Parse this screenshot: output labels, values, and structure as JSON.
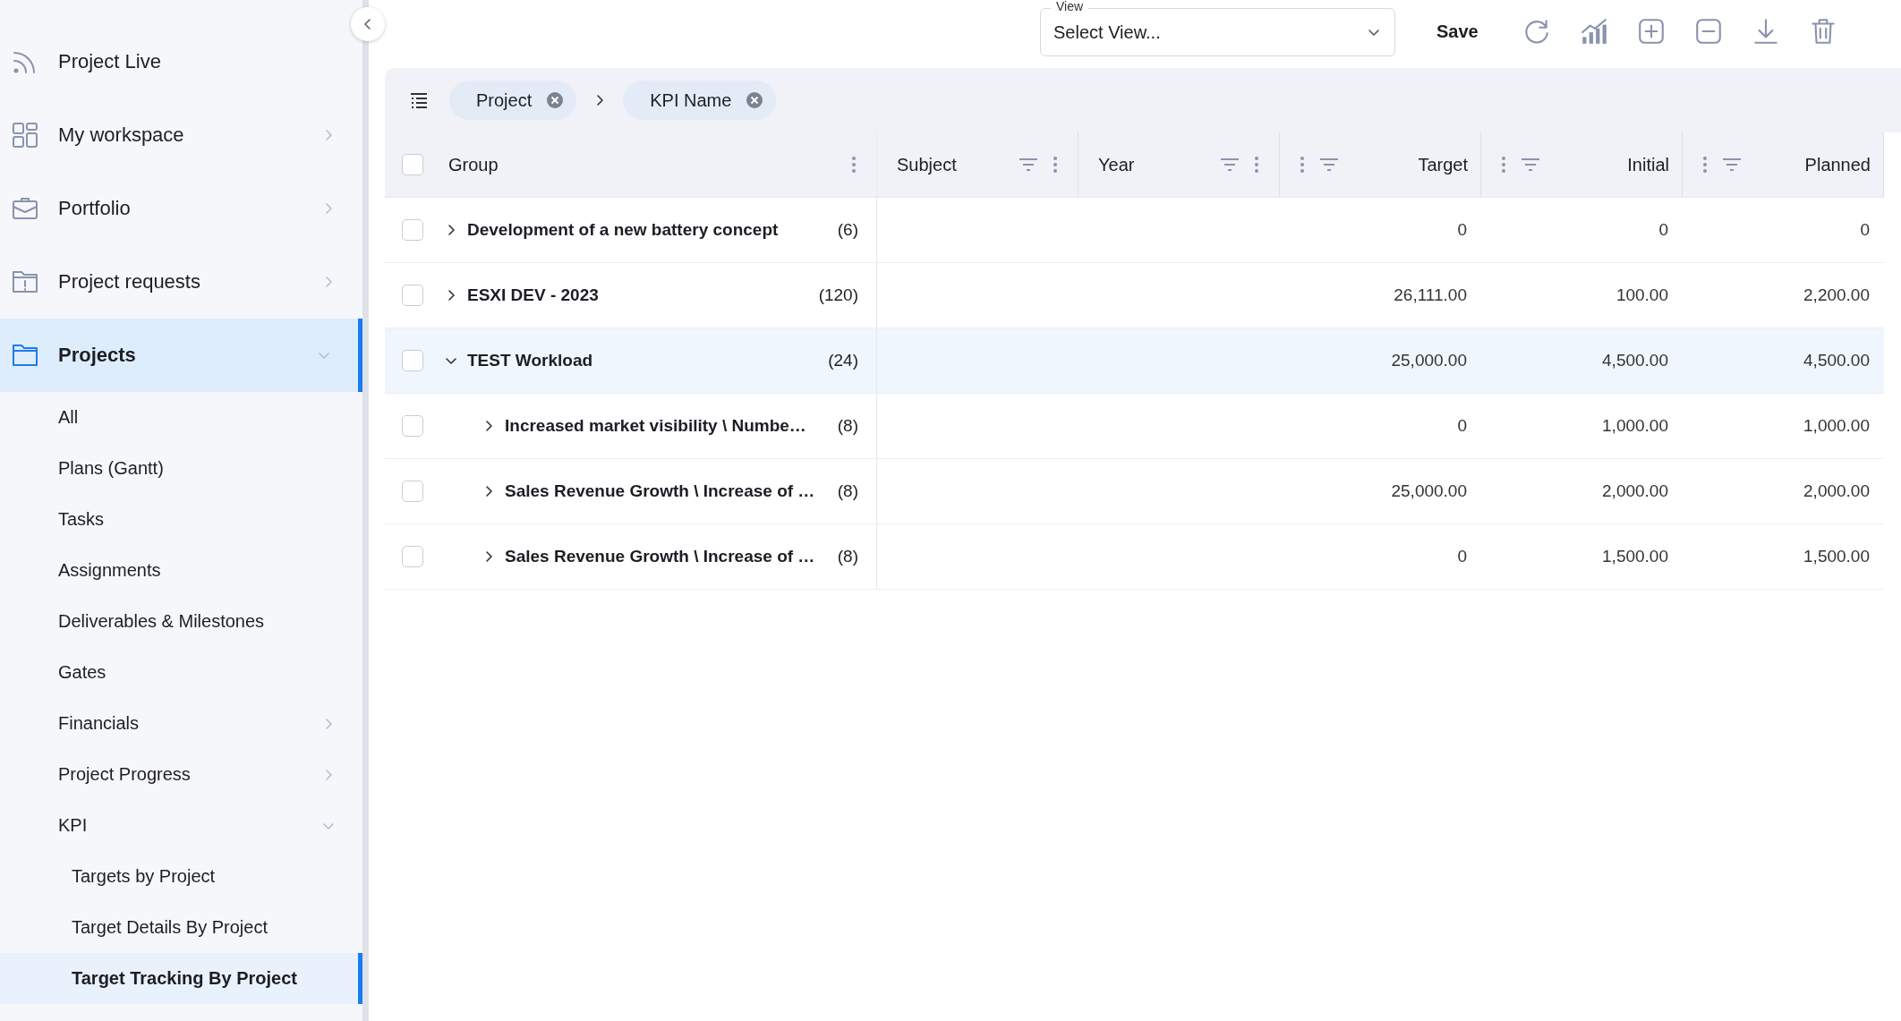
{
  "sidebar": {
    "items": [
      {
        "label": "Project Live",
        "kind": "rss",
        "selected": false
      },
      {
        "label": "My workspace",
        "kind": "grid",
        "expanded": false,
        "selected": false
      },
      {
        "label": "Portfolio",
        "kind": "briefcase",
        "expanded": false,
        "selected": false
      },
      {
        "label": "Project requests",
        "kind": "request",
        "expanded": false,
        "selected": false
      },
      {
        "label": "Projects",
        "kind": "folder",
        "expanded": true,
        "selected": true,
        "children": [
          {
            "label": "All",
            "selected": false
          },
          {
            "label": "Plans (Gantt)",
            "selected": false
          },
          {
            "label": "Tasks",
            "selected": false
          },
          {
            "label": "Assignments",
            "selected": false
          },
          {
            "label": "Deliverables & Milestones",
            "selected": false
          },
          {
            "label": "Gates",
            "selected": false
          },
          {
            "label": "Financials",
            "expanded": false,
            "selected": false
          },
          {
            "label": "Project Progress",
            "expanded": false,
            "selected": false
          },
          {
            "label": "KPI",
            "expanded": true,
            "selected": false,
            "children": [
              {
                "label": "Targets by Project",
                "selected": false
              },
              {
                "label": "Target Details By Project",
                "selected": false
              },
              {
                "label": "Target Tracking By Project",
                "selected": true
              }
            ]
          }
        ]
      }
    ]
  },
  "toolbar": {
    "view_field": {
      "label": "View",
      "placeholder": "Select View..."
    },
    "save_button": "Save",
    "actions": [
      {
        "kind": "refresh"
      },
      {
        "kind": "chart"
      },
      {
        "kind": "add"
      },
      {
        "kind": "remove"
      },
      {
        "kind": "download"
      },
      {
        "kind": "delete"
      }
    ]
  },
  "grid": {
    "group_panel": {
      "chips": [
        {
          "label": "Project"
        },
        {
          "label": "KPI Name"
        }
      ]
    },
    "header_checkbox": {
      "checked": false
    },
    "columns": [
      {
        "label": "Group",
        "kind": "group"
      },
      {
        "label": "Subject",
        "kind": "text"
      },
      {
        "label": "Year",
        "kind": "text"
      },
      {
        "label": "Target",
        "kind": "number"
      },
      {
        "label": "Initial",
        "kind": "number"
      },
      {
        "label": "Planned",
        "kind": "number"
      }
    ],
    "rows": [
      {
        "label": "Development of a new battery concept",
        "count": "(6)",
        "expanded": false,
        "selected": false,
        "checked": false,
        "values": [
          "0",
          "0",
          "0"
        ]
      },
      {
        "label": "ESXI DEV - 2023",
        "count": "(120)",
        "expanded": false,
        "selected": false,
        "checked": false,
        "values": [
          "26,111.00",
          "100.00",
          "2,200.00"
        ]
      },
      {
        "label": "TEST Workload",
        "count": "(24)",
        "expanded": true,
        "selected": true,
        "checked": false,
        "values": [
          "25,000.00",
          "4,500.00",
          "4,500.00"
        ],
        "children": [
          {
            "label": "Increased market visibility \\ Numbe…",
            "count": "(8)",
            "expanded": false,
            "selected": false,
            "checked": false,
            "values": [
              "0",
              "1,000.00",
              "1,000.00"
            ]
          },
          {
            "label": "Sales Revenue Growth \\ Increase of …",
            "count": "(8)",
            "expanded": false,
            "selected": false,
            "checked": false,
            "values": [
              "25,000.00",
              "2,000.00",
              "2,000.00"
            ]
          },
          {
            "label": "Sales Revenue Growth \\ Increase of …",
            "count": "(8)",
            "expanded": false,
            "selected": false,
            "checked": false,
            "values": [
              "0",
              "1,500.00",
              "1,500.00"
            ]
          }
        ]
      }
    ]
  }
}
